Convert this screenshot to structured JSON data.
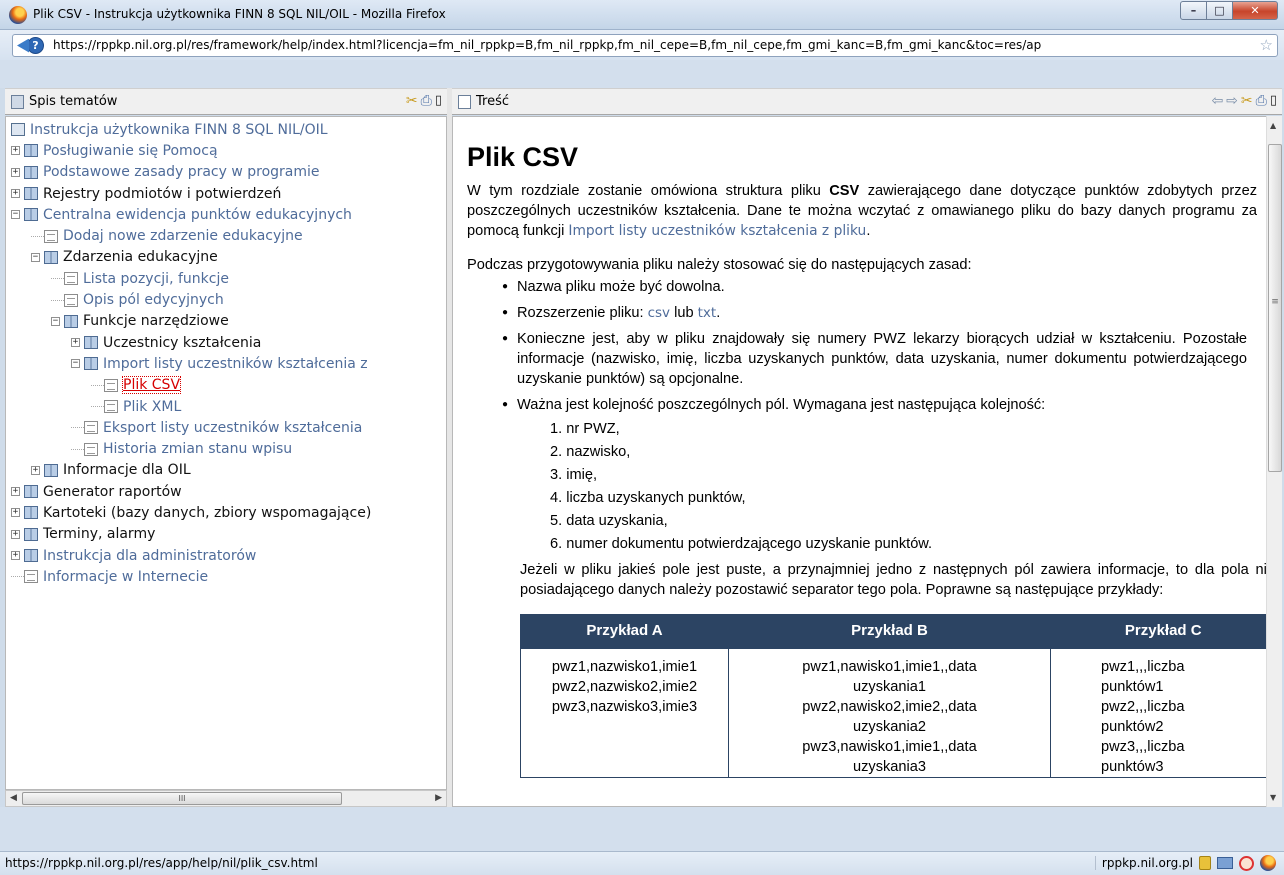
{
  "window": {
    "title": "Plik CSV - Instrukcja użytkownika FINN 8 SQL NIL/OIL - Mozilla Firefox",
    "buttons": {
      "minimize": "–",
      "maximize": "□",
      "close": "✕"
    }
  },
  "address": {
    "url": "https://rppkp.nil.org.pl/res/framework/help/index.html?licencja=fm_nil_rppkp=B,fm_nil_rppkp,fm_nil_cepe=B,fm_nil_cepe,fm_gmi_kanc=B,fm_gmi_kanc&toc=res/ap",
    "site_identity": "?"
  },
  "left_pane": {
    "title": "Spis tematów",
    "tree": [
      {
        "label": "Instrukcja użytkownika FINN 8 SQL NIL/OIL",
        "depth": 0,
        "expander": "",
        "icon": "root",
        "style": "link"
      },
      {
        "label": "Posługiwanie się Pomocą",
        "depth": 0,
        "expander": "+",
        "icon": "book",
        "style": "link"
      },
      {
        "label": "Podstawowe zasady pracy w programie",
        "depth": 0,
        "expander": "+",
        "icon": "book",
        "style": "link"
      },
      {
        "label": "Rejestry podmiotów i potwierdzeń",
        "depth": 0,
        "expander": "+",
        "icon": "book",
        "style": "plain"
      },
      {
        "label": "Centralna ewidencja punktów edukacyjnych",
        "depth": 0,
        "expander": "-",
        "icon": "book",
        "style": "link"
      },
      {
        "label": "Dodaj nowe zdarzenie edukacyjne",
        "depth": 1,
        "expander": "",
        "icon": "page",
        "style": "link"
      },
      {
        "label": "Zdarzenia edukacyjne",
        "depth": 1,
        "expander": "-",
        "icon": "book",
        "style": "plain"
      },
      {
        "label": "Lista pozycji, funkcje",
        "depth": 2,
        "expander": "",
        "icon": "page",
        "style": "link"
      },
      {
        "label": "Opis pól edycyjnych",
        "depth": 2,
        "expander": "",
        "icon": "page",
        "style": "link"
      },
      {
        "label": "Funkcje narzędziowe",
        "depth": 2,
        "expander": "-",
        "icon": "book",
        "style": "plain"
      },
      {
        "label": "Uczestnicy kształcenia",
        "depth": 3,
        "expander": "+",
        "icon": "book",
        "style": "plain"
      },
      {
        "label": "Import listy uczestników kształcenia z",
        "depth": 3,
        "expander": "-",
        "icon": "book",
        "style": "link"
      },
      {
        "label": "Plik CSV",
        "depth": 4,
        "expander": "",
        "icon": "page",
        "style": "active"
      },
      {
        "label": "Plik XML",
        "depth": 4,
        "expander": "",
        "icon": "page",
        "style": "link"
      },
      {
        "label": "Eksport listy uczestników kształcenia",
        "depth": 3,
        "expander": "",
        "icon": "page",
        "style": "link"
      },
      {
        "label": "Historia zmian stanu wpisu",
        "depth": 3,
        "expander": "",
        "icon": "page",
        "style": "link"
      },
      {
        "label": "Informacje dla OIL",
        "depth": 1,
        "expander": "+",
        "icon": "book",
        "style": "plain"
      },
      {
        "label": "Generator raportów",
        "depth": 0,
        "expander": "+",
        "icon": "book",
        "style": "plain"
      },
      {
        "label": "Kartoteki (bazy danych, zbiory wspomagające)",
        "depth": 0,
        "expander": "+",
        "icon": "book",
        "style": "plain"
      },
      {
        "label": "Terminy, alarmy",
        "depth": 0,
        "expander": "+",
        "icon": "book",
        "style": "plain"
      },
      {
        "label": "Instrukcja dla administratorów",
        "depth": 0,
        "expander": "+",
        "icon": "book",
        "style": "link"
      },
      {
        "label": "Informacje w Internecie",
        "depth": 0,
        "expander": "",
        "icon": "page",
        "style": "link"
      }
    ],
    "hscroll_thumb": "III"
  },
  "right_pane": {
    "title": "Treść"
  },
  "content": {
    "heading": "Plik CSV",
    "intro_before_bold": "W tym rozdziale zostanie omówiona struktura pliku ",
    "intro_bold": "CSV",
    "intro_after_bold": " zawierającego dane dotyczące punktów zdobytych przez poszczególnych uczestników kształcenia. Dane te można wczytać z omawianego pliku do bazy danych programu za pomocą funkcji ",
    "intro_link": "Import listy uczestników kształcenia z pliku",
    "intro_end": ".",
    "rules_intro": "Podczas przygotowywania pliku należy stosować się do następujących zasad:",
    "bullet1": "Nazwa pliku może być dowolna.",
    "bullet2_before": "Rozszerzenie pliku: ",
    "bullet2_csv": "csv",
    "bullet2_mid": " lub ",
    "bullet2_txt": "txt",
    "bullet2_end": ".",
    "bullet3": "Konieczne jest, aby w pliku znajdowały się numery PWZ lekarzy biorących udział w kształceniu. Pozostałe informacje (nazwisko, imię, liczba uzyskanych punktów, data uzyskania, numer dokumentu potwierdzającego uzyskanie punktów) są opcjonalne.",
    "bullet4": "Ważna jest kolejność poszczególnych pól. Wymagana jest następująca kolejność:",
    "order": [
      "1. nr PWZ,",
      "2. nazwisko,",
      "3. imię,",
      "4. liczba uzyskanych punktów,",
      "5. data uzyskania,",
      "6. numer dokumentu potwierdzającego uzyskanie punktów."
    ],
    "after_list": "Jeżeli w pliku jakieś pole jest puste, a przynajmniej jedno z następnych pól zawiera informacje, to dla pola nie posiadającego danych należy pozostawić separator tego pola. Poprawne są następujące przykłady:",
    "table": {
      "headers": [
        "Przykład A",
        "Przykład B",
        "Przykład C"
      ],
      "col_a": [
        "pwz1,nazwisko1,imie1",
        "pwz2,nazwisko2,imie2",
        "pwz3,nazwisko3,imie3"
      ],
      "col_b": [
        "pwz1,nawisko1,imie1,,data",
        "uzyskania1",
        "pwz2,nawisko2,imie2,,data",
        "uzyskania2",
        "pwz3,nawisko1,imie1,,data",
        "uzyskania3"
      ],
      "col_c": [
        "pwz1,,,liczba",
        "punktów1",
        "pwz2,,,liczba",
        "punktów2",
        "pwz3,,,liczba",
        "punktów3"
      ]
    }
  },
  "status": {
    "url": "https://rppkp.nil.org.pl/res/app/help/nil/plik_csv.html",
    "domain": "rppkp.nil.org.pl"
  },
  "colors": {
    "link": "#4f6c9a",
    "active": "#d60000",
    "table_header": "#2c4463"
  }
}
